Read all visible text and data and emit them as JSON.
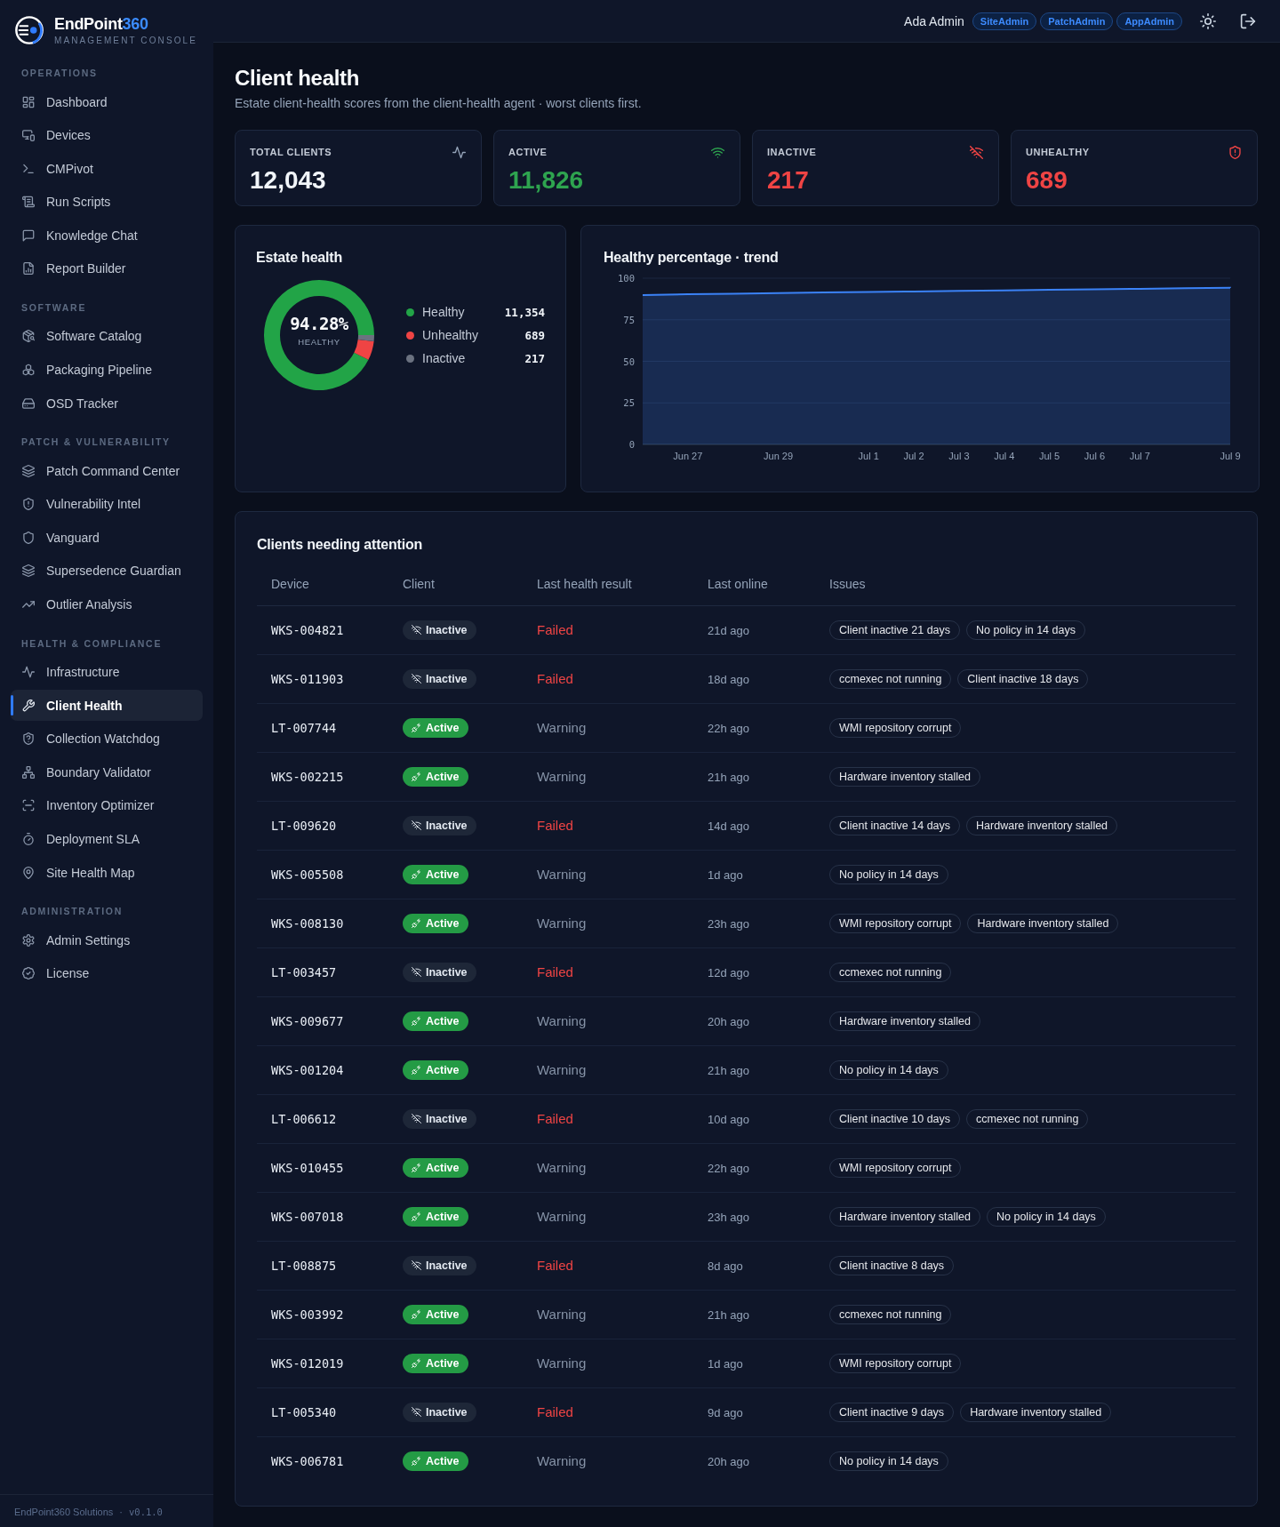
{
  "brand": {
    "name": "EndPoint",
    "accent": "360",
    "tagline": "MANAGEMENT CONSOLE"
  },
  "sidebar": {
    "sections": [
      {
        "title": "OPERATIONS",
        "items": [
          {
            "label": "Dashboard",
            "selected": false
          },
          {
            "label": "Devices",
            "selected": false
          },
          {
            "label": "CMPivot",
            "selected": false
          },
          {
            "label": "Run Scripts",
            "selected": false
          },
          {
            "label": "Knowledge Chat",
            "selected": false
          },
          {
            "label": "Report Builder",
            "selected": false
          }
        ]
      },
      {
        "title": "SOFTWARE",
        "items": [
          {
            "label": "Software Catalog",
            "selected": false
          },
          {
            "label": "Packaging Pipeline",
            "selected": false
          },
          {
            "label": "OSD Tracker",
            "selected": false
          }
        ]
      },
      {
        "title": "PATCH & VULNERABILITY",
        "items": [
          {
            "label": "Patch Command Center",
            "selected": false
          },
          {
            "label": "Vulnerability Intel",
            "selected": false
          },
          {
            "label": "Vanguard",
            "selected": false
          },
          {
            "label": "Supersedence Guardian",
            "selected": false
          },
          {
            "label": "Outlier Analysis",
            "selected": false
          }
        ]
      },
      {
        "title": "HEALTH & COMPLIANCE",
        "items": [
          {
            "label": "Infrastructure",
            "selected": false
          },
          {
            "label": "Client Health",
            "selected": true
          },
          {
            "label": "Collection Watchdog",
            "selected": false
          },
          {
            "label": "Boundary Validator",
            "selected": false
          },
          {
            "label": "Inventory Optimizer",
            "selected": false
          },
          {
            "label": "Deployment SLA",
            "selected": false
          },
          {
            "label": "Site Health Map",
            "selected": false
          }
        ]
      },
      {
        "title": "ADMINISTRATION",
        "items": [
          {
            "label": "Admin Settings",
            "selected": false
          },
          {
            "label": "License",
            "selected": false
          }
        ]
      }
    ]
  },
  "footer": {
    "company": "EndPoint360 Solutions",
    "separator": "·",
    "version": "v0.1.0"
  },
  "header": {
    "user": "Ada Admin",
    "roles": [
      "SiteAdmin",
      "PatchAdmin",
      "AppAdmin"
    ]
  },
  "page": {
    "title": "Client health",
    "subtitle": "Estate client-health scores from the client-health agent · worst clients first."
  },
  "stats": [
    {
      "label": "TOTAL CLIENTS",
      "value": "12,043",
      "kind": "total"
    },
    {
      "label": "ACTIVE",
      "value": "11,826",
      "kind": "active"
    },
    {
      "label": "INACTIVE",
      "value": "217",
      "kind": "inactive"
    },
    {
      "label": "UNHEALTHY",
      "value": "689",
      "kind": "unhealthy"
    }
  ],
  "estate_health": {
    "title": "Estate health",
    "center_value": "94.28%",
    "center_label": "HEALTHY",
    "chart_data": {
      "type": "donut",
      "categories": [
        "Healthy",
        "Unhealthy",
        "Inactive"
      ],
      "values": [
        11354,
        689,
        217
      ],
      "value_labels": [
        "11,354",
        "689",
        "217"
      ],
      "colors": [
        "#22a447",
        "#ef4444",
        "#6b7280"
      ],
      "legend": "right"
    }
  },
  "trend": {
    "title": "Healthy percentage · trend",
    "chart_data": {
      "type": "area",
      "categories": [
        null,
        "Jun 27",
        null,
        "Jun 29",
        null,
        "Jul 1",
        "Jul 2",
        "Jul 3",
        "Jul 4",
        "Jul 5",
        "Jul 6",
        "Jul 7",
        null,
        "Jul 9"
      ],
      "series": [
        {
          "color": "#3b82f6",
          "values": [
            89.9,
            90.3,
            90.7,
            91.0,
            91.4,
            91.7,
            92.0,
            92.4,
            92.7,
            93.0,
            93.3,
            93.6,
            94.0,
            94.3
          ]
        }
      ],
      "ylim": [
        0,
        100
      ],
      "yticks": [
        0,
        25,
        50,
        75,
        100
      ],
      "grid": true
    }
  },
  "table": {
    "title": "Clients needing attention",
    "columns": [
      "Device",
      "Client",
      "Last health result",
      "Last online",
      "Issues"
    ],
    "rows": [
      {
        "device": "WKS-004821",
        "client": "Inactive",
        "client_active": false,
        "result": "Failed",
        "result_failed": true,
        "last_online": "21d ago",
        "issues": [
          "Client inactive 21 days",
          "No policy in 14 days"
        ]
      },
      {
        "device": "WKS-011903",
        "client": "Inactive",
        "client_active": false,
        "result": "Failed",
        "result_failed": true,
        "last_online": "18d ago",
        "issues": [
          "ccmexec not running",
          "Client inactive 18 days"
        ]
      },
      {
        "device": "LT-007744",
        "client": "Active",
        "client_active": true,
        "result": "Warning",
        "result_failed": false,
        "last_online": "22h ago",
        "issues": [
          "WMI repository corrupt"
        ]
      },
      {
        "device": "WKS-002215",
        "client": "Active",
        "client_active": true,
        "result": "Warning",
        "result_failed": false,
        "last_online": "21h ago",
        "issues": [
          "Hardware inventory stalled"
        ]
      },
      {
        "device": "LT-009620",
        "client": "Inactive",
        "client_active": false,
        "result": "Failed",
        "result_failed": true,
        "last_online": "14d ago",
        "issues": [
          "Client inactive 14 days",
          "Hardware inventory stalled"
        ]
      },
      {
        "device": "WKS-005508",
        "client": "Active",
        "client_active": true,
        "result": "Warning",
        "result_failed": false,
        "last_online": "1d ago",
        "issues": [
          "No policy in 14 days"
        ]
      },
      {
        "device": "WKS-008130",
        "client": "Active",
        "client_active": true,
        "result": "Warning",
        "result_failed": false,
        "last_online": "23h ago",
        "issues": [
          "WMI repository corrupt",
          "Hardware inventory stalled"
        ]
      },
      {
        "device": "LT-003457",
        "client": "Inactive",
        "client_active": false,
        "result": "Failed",
        "result_failed": true,
        "last_online": "12d ago",
        "issues": [
          "ccmexec not running"
        ]
      },
      {
        "device": "WKS-009677",
        "client": "Active",
        "client_active": true,
        "result": "Warning",
        "result_failed": false,
        "last_online": "20h ago",
        "issues": [
          "Hardware inventory stalled"
        ]
      },
      {
        "device": "WKS-001204",
        "client": "Active",
        "client_active": true,
        "result": "Warning",
        "result_failed": false,
        "last_online": "21h ago",
        "issues": [
          "No policy in 14 days"
        ]
      },
      {
        "device": "LT-006612",
        "client": "Inactive",
        "client_active": false,
        "result": "Failed",
        "result_failed": true,
        "last_online": "10d ago",
        "issues": [
          "Client inactive 10 days",
          "ccmexec not running"
        ]
      },
      {
        "device": "WKS-010455",
        "client": "Active",
        "client_active": true,
        "result": "Warning",
        "result_failed": false,
        "last_online": "22h ago",
        "issues": [
          "WMI repository corrupt"
        ]
      },
      {
        "device": "WKS-007018",
        "client": "Active",
        "client_active": true,
        "result": "Warning",
        "result_failed": false,
        "last_online": "23h ago",
        "issues": [
          "Hardware inventory stalled",
          "No policy in 14 days"
        ]
      },
      {
        "device": "LT-008875",
        "client": "Inactive",
        "client_active": false,
        "result": "Failed",
        "result_failed": true,
        "last_online": "8d ago",
        "issues": [
          "Client inactive 8 days"
        ]
      },
      {
        "device": "WKS-003992",
        "client": "Active",
        "client_active": true,
        "result": "Warning",
        "result_failed": false,
        "last_online": "21h ago",
        "issues": [
          "ccmexec not running"
        ]
      },
      {
        "device": "WKS-012019",
        "client": "Active",
        "client_active": true,
        "result": "Warning",
        "result_failed": false,
        "last_online": "1d ago",
        "issues": [
          "WMI repository corrupt"
        ]
      },
      {
        "device": "LT-005340",
        "client": "Inactive",
        "client_active": false,
        "result": "Failed",
        "result_failed": true,
        "last_online": "9d ago",
        "issues": [
          "Client inactive 9 days",
          "Hardware inventory stalled"
        ]
      },
      {
        "device": "WKS-006781",
        "client": "Active",
        "client_active": true,
        "result": "Warning",
        "result_failed": false,
        "last_online": "20h ago",
        "issues": [
          "No policy in 14 days"
        ]
      }
    ]
  }
}
